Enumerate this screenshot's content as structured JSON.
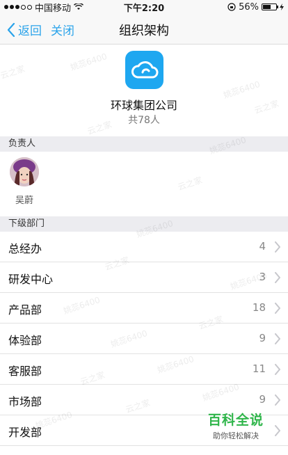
{
  "status_bar": {
    "carrier": "中国移动",
    "time": "下午2:20",
    "battery": "56%"
  },
  "nav": {
    "back_label": "返回",
    "close_label": "关闭",
    "title": "组织架构"
  },
  "company": {
    "name": "环球集团公司",
    "member_count": "共78人"
  },
  "manager_section": {
    "header": "负责人",
    "name": "吴蔚"
  },
  "departments_section": {
    "header": "下级部门",
    "items": [
      {
        "name": "总经办",
        "count": "4"
      },
      {
        "name": "研发中心",
        "count": "3"
      },
      {
        "name": "产品部",
        "count": "18"
      },
      {
        "name": "体验部",
        "count": "9"
      },
      {
        "name": "客服部",
        "count": "11"
      },
      {
        "name": "市场部",
        "count": "9"
      },
      {
        "name": "开发部",
        "count": ""
      }
    ]
  },
  "brand": {
    "title": "百科全说",
    "subtitle": "助你轻松解决"
  },
  "watermark": {
    "text_a": "姚蕊6400",
    "text_b": "云之家"
  },
  "colors": {
    "accent": "#2aa3ea",
    "logo": "#1ea7f0",
    "brand_green": "#2fb54a"
  }
}
